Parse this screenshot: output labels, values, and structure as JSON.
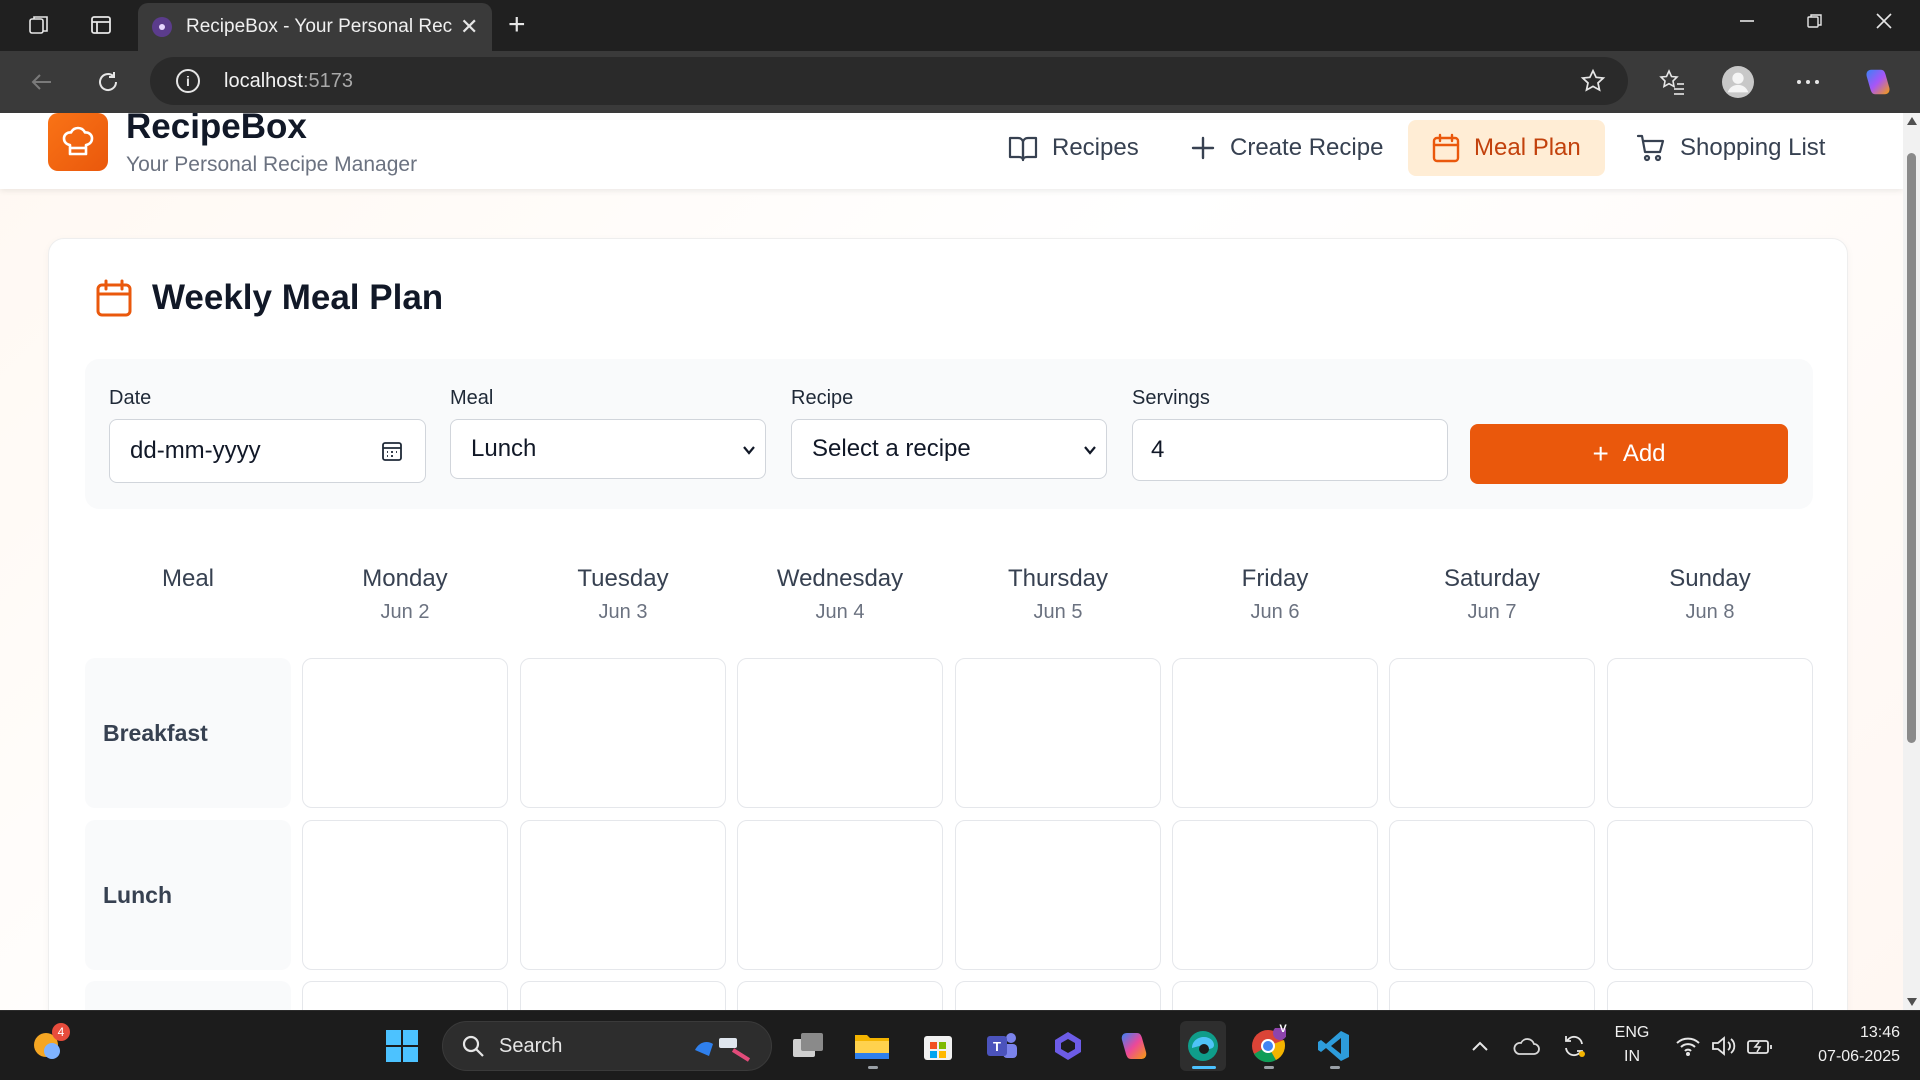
{
  "browser": {
    "tab_title": "RecipeBox - Your Personal Recipe Manager",
    "url_host": "localhost",
    "url_port": ":5173"
  },
  "header": {
    "brand": "RecipeBox",
    "tagline": "Your Personal Recipe Manager",
    "nav": [
      {
        "label": "Recipes",
        "icon": "book-icon"
      },
      {
        "label": "Create Recipe",
        "icon": "plus-icon"
      },
      {
        "label": "Meal Plan",
        "icon": "calendar-icon",
        "active": true
      },
      {
        "label": "Shopping List",
        "icon": "cart-icon"
      }
    ]
  },
  "page": {
    "title": "Weekly Meal Plan"
  },
  "form": {
    "date_label": "Date",
    "date_placeholder": "dd-mm-yyyy",
    "meal_label": "Meal",
    "meal_value": "Lunch",
    "recipe_label": "Recipe",
    "recipe_value": "Select a recipe",
    "servings_label": "Servings",
    "servings_value": "4",
    "add_label": "Add"
  },
  "grid": {
    "meal_header": "Meal",
    "days": [
      {
        "day": "Monday",
        "date": "Jun 2"
      },
      {
        "day": "Tuesday",
        "date": "Jun 3"
      },
      {
        "day": "Wednesday",
        "date": "Jun 4"
      },
      {
        "day": "Thursday",
        "date": "Jun 5"
      },
      {
        "day": "Friday",
        "date": "Jun 6"
      },
      {
        "day": "Saturday",
        "date": "Jun 7"
      },
      {
        "day": "Sunday",
        "date": "Jun 8"
      }
    ],
    "meals": [
      "Breakfast",
      "Lunch"
    ]
  },
  "taskbar": {
    "search_label": "Search",
    "notification_count": "4",
    "lang_top": "ENG",
    "lang_bottom": "IN",
    "time": "13:46",
    "date": "07-06-2025",
    "chrome_badge": "V"
  },
  "colors": {
    "accent": "#ea580c",
    "active_nav_bg": "#ffedd5"
  }
}
